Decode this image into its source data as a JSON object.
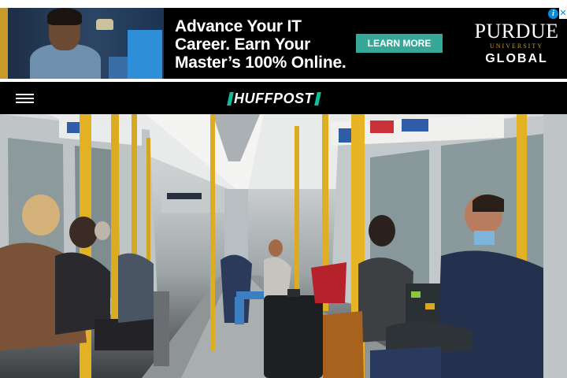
{
  "ad": {
    "headline": [
      "Advance Your IT",
      "Career. Earn Your",
      "Master’s 100% Online."
    ],
    "cta_label": "LEARN MORE",
    "brand_line1": "PURDUE",
    "brand_line2": "UNIVERSITY",
    "brand_line3": "GLOBAL",
    "info_glyph": "i",
    "close_glyph": "✕",
    "accent_color": "#c79a2a",
    "cta_color": "#35a89a"
  },
  "header": {
    "menu_icon": "hamburger-menu-icon",
    "logo_text": "HUFFPOST",
    "logo_accent_color": "#0dbe98"
  },
  "hero": {
    "image_subject": "photo"
  }
}
